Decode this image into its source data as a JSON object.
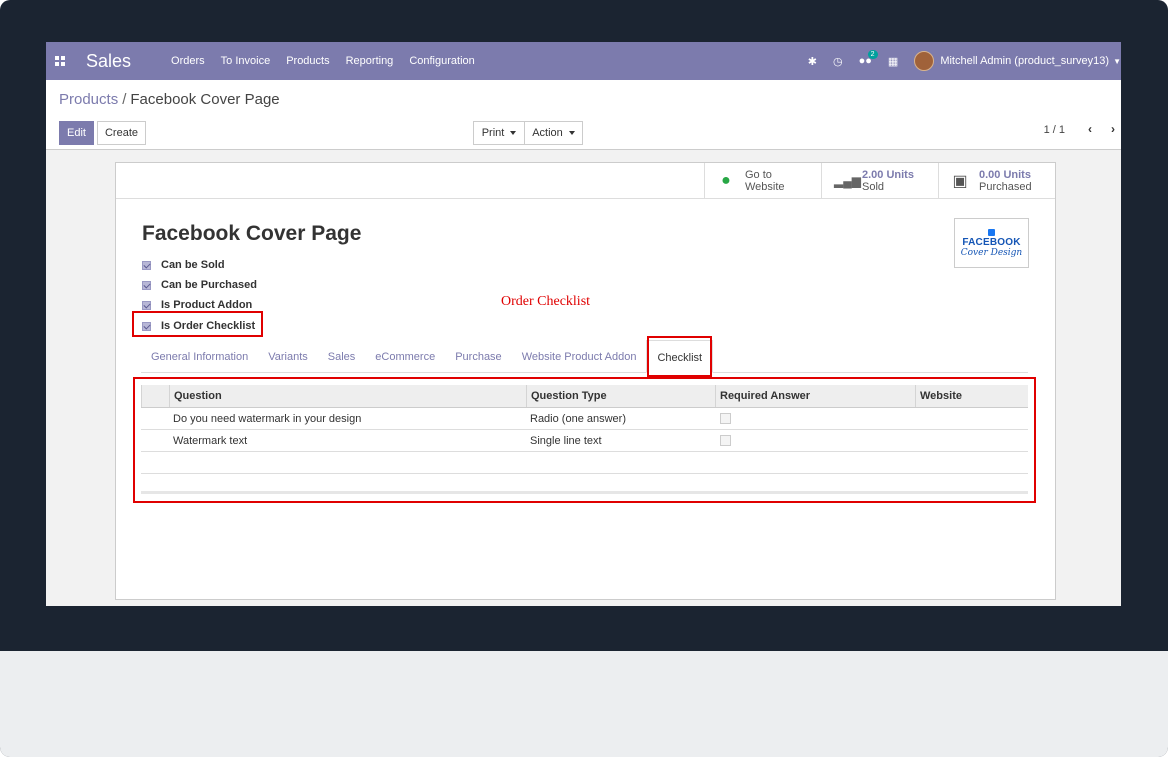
{
  "navbar": {
    "app_name": "Sales",
    "menu": [
      "Orders",
      "To Invoice",
      "Products",
      "Reporting",
      "Configuration"
    ],
    "chat_count": "2",
    "user": "Mitchell Admin (product_survey13)"
  },
  "breadcrumb": {
    "parent": "Products",
    "separator": "/",
    "current": "Facebook Cover Page"
  },
  "toolbar": {
    "edit_label": "Edit",
    "create_label": "Create",
    "print_label": "Print",
    "action_label": "Action"
  },
  "pager": {
    "text": "1 / 1"
  },
  "stat_buttons": {
    "website": {
      "line1": "Go to",
      "line2": "Website"
    },
    "sold": {
      "value": "2.00 Units",
      "label": "Sold"
    },
    "purchased": {
      "value": "0.00 Units",
      "label": "Purchased"
    }
  },
  "product": {
    "name": "Facebook Cover Page",
    "image_text_1": "FACEBOOK",
    "image_text_2": "Cover Design",
    "checkboxes": [
      {
        "label": "Can be Sold",
        "checked": true
      },
      {
        "label": "Can be Purchased",
        "checked": true
      },
      {
        "label": "Is Product Addon",
        "checked": true
      },
      {
        "label": "Is Order Checklist",
        "checked": true
      }
    ]
  },
  "annotation": "Order Checklist",
  "tabs": [
    "General Information",
    "Variants",
    "Sales",
    "eCommerce",
    "Purchase",
    "Website Product Addon",
    "Checklist"
  ],
  "active_tab": "Checklist",
  "table": {
    "headers": [
      "Question",
      "Question Type",
      "Required Answer",
      "Website"
    ],
    "rows": [
      {
        "question": "Do you need watermark in your design",
        "type": "Radio (one answer)",
        "required": false
      },
      {
        "question": "Watermark text",
        "type": "Single line text",
        "required": false
      }
    ]
  },
  "colors": {
    "brand": "#7c7bad",
    "highlight": "#e00000"
  }
}
